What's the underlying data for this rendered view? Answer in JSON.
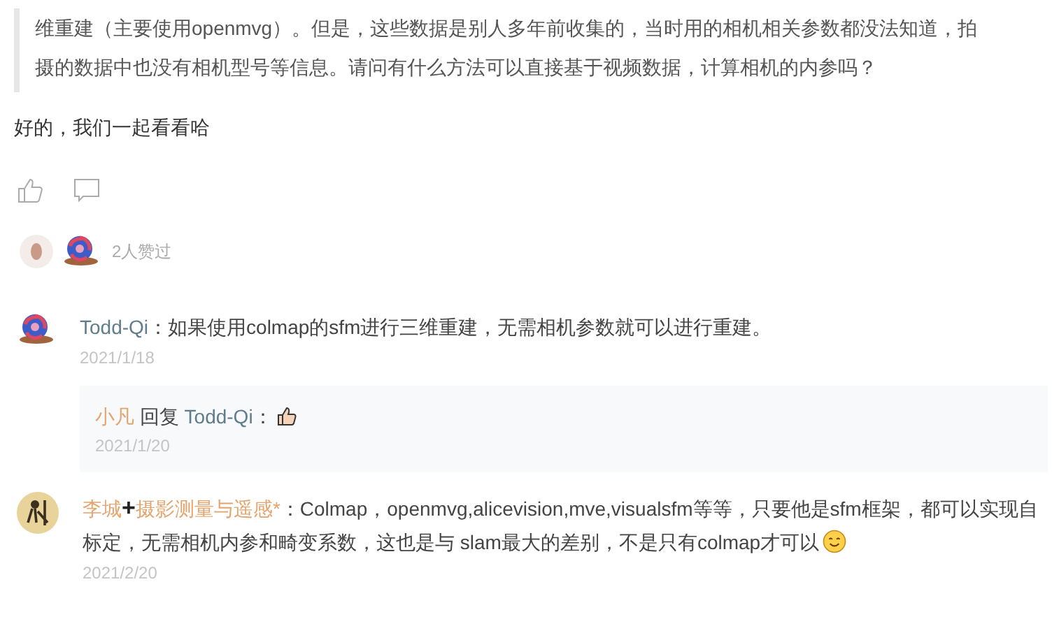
{
  "question_quote": {
    "lines": [
      "维重建（主要使用openmvg）。但是，这些数据是别人多年前收集的，当时用的相机相关参数都没法知道，拍",
      "摄的数据中也没有相机型号等信息。请问有什么方法可以直接基于视频数据，计算相机的内参吗？"
    ]
  },
  "answer": "好的，我们一起看看哈",
  "likes": {
    "count_text": "2人赞过"
  },
  "comments": [
    {
      "kind": "snail",
      "author": "Todd-Qi",
      "color": "#5f7d8c",
      "text": "：如果使用colmap的sfm进行三维重建，无需相机参数就可以进行重建。",
      "date": "2021/1/18",
      "replies": [
        {
          "author": "小凡",
          "color": "#e3a46e",
          "verb": "回复",
          "reply_to": "Todd-Qi",
          "text": "：",
          "end_icon": {
            "kind": "thumbs-up"
          },
          "date": "2021/1/20"
        }
      ]
    },
    {
      "kind": "person",
      "author": "李城",
      "color": "#e3a46e",
      "badge": "+",
      "author_suffix": "摄影测量与遥感*",
      "text": "：Colmap，openmvg,alicevision,mve,visualsfm等等，只要他是sfm框架，都可以实现自标定，无需相机内参和畸变系数，这也是与 slam最大的差别，不是只有colmap才可以",
      "date": "2021/2/20",
      "end_icon": {
        "kind": "smiley"
      }
    }
  ]
}
